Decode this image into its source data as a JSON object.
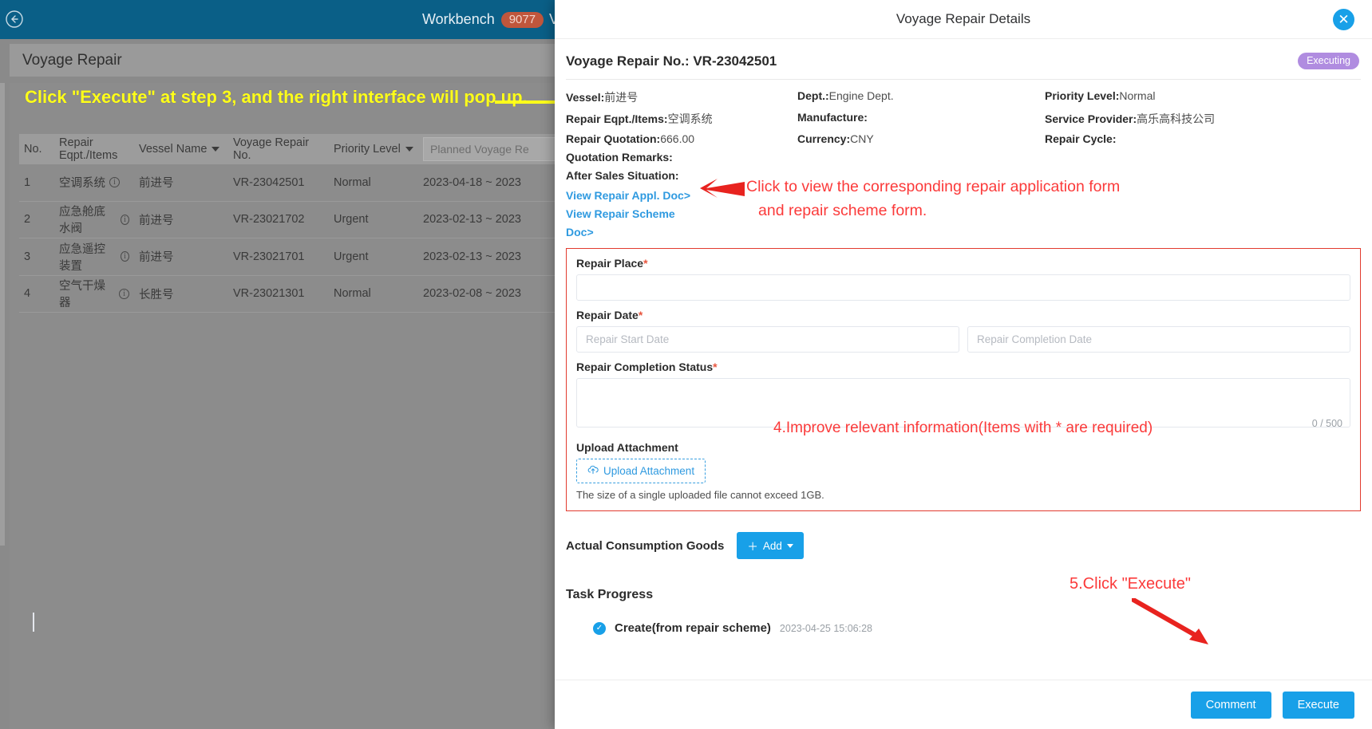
{
  "background": {
    "topbar": {
      "back_icon": "back-arrow-circle-icon",
      "workbench_label": "Workbench",
      "workbench_badge": "9077",
      "next_label": "V",
      "bg_color": "#0a5f87"
    },
    "page_title": "Voyage Repair",
    "annotation_banner": "Click \"Execute\" at step 3, and the right interface will pop up.",
    "table": {
      "columns": [
        {
          "label": "No.",
          "sortable": false
        },
        {
          "label": "Repair Eqpt./Items",
          "sortable": false
        },
        {
          "label": "Vessel Name",
          "sortable": true
        },
        {
          "label": "Voyage Repair No.",
          "sortable": false
        },
        {
          "label": "Priority Level",
          "sortable": true
        },
        {
          "label": "Planned Voyage Re",
          "sortable": false,
          "is_filter": true
        }
      ],
      "rows": [
        {
          "no": "1",
          "eqpt": "空调系统",
          "vessel": "前进号",
          "vrno": "VR-23042501",
          "priority": "Normal",
          "planned": "2023-04-18  ~  2023"
        },
        {
          "no": "2",
          "eqpt": "应急舱底水阀",
          "vessel": "前进号",
          "vrno": "VR-23021702",
          "priority": "Urgent",
          "planned": "2023-02-13  ~  2023"
        },
        {
          "no": "3",
          "eqpt": "应急遥控装置",
          "vessel": "前进号",
          "vrno": "VR-23021701",
          "priority": "Urgent",
          "planned": "2023-02-13  ~  2023"
        },
        {
          "no": "4",
          "eqpt": "空气干燥器",
          "vessel": "长胜号",
          "vrno": "VR-23021301",
          "priority": "Normal",
          "planned": "2023-02-08  ~  2023"
        }
      ]
    }
  },
  "modal": {
    "title": "Voyage Repair Details",
    "close_icon": "close-icon",
    "repair_no_text": "Voyage Repair No.: VR-23042501",
    "status_badge": "Executing",
    "status_badge_color": "#b08ce0",
    "meta": [
      {
        "label": "Vessel:",
        "value": "前进号"
      },
      {
        "label": "Dept.:",
        "value": "Engine Dept."
      },
      {
        "label": "Priority Level:",
        "value": "Normal"
      },
      {
        "label": "Repair Eqpt./Items:",
        "value": "空调系统"
      },
      {
        "label": "Manufacture:",
        "value": ""
      },
      {
        "label": "Service Provider:",
        "value": "高乐高科技公司"
      },
      {
        "label": "Repair Quotation:",
        "value": "666.00"
      },
      {
        "label": "Currency:",
        "value": "CNY"
      },
      {
        "label": "Repair Cycle:",
        "value": ""
      },
      {
        "label": "Quotation Remarks:",
        "value": ""
      },
      {
        "label": "",
        "value": ""
      },
      {
        "label": "",
        "value": ""
      },
      {
        "label": "After Sales Situation:",
        "value": ""
      },
      {
        "label": "",
        "value": ""
      },
      {
        "label": "",
        "value": ""
      }
    ],
    "doc_links": [
      {
        "label": "View Repair Appl. Doc>"
      },
      {
        "label": "View Repair Scheme Doc>"
      }
    ],
    "form": {
      "repair_place_label": "Repair Place",
      "repair_place_value": "",
      "repair_place_placeholder": "",
      "repair_date_label": "Repair Date",
      "repair_start_placeholder": "Repair Start Date",
      "repair_start_value": "",
      "repair_completion_placeholder": "Repair Completion Date",
      "repair_completion_value": "",
      "completion_status_label": "Repair Completion Status",
      "completion_status_value": "",
      "completion_status_counter": "0 / 500",
      "upload_label": "Upload Attachment",
      "upload_button": "Upload Attachment",
      "upload_icon": "cloud-upload-icon",
      "upload_hint": "The size of a single uploaded file cannot exceed 1GB.",
      "required_marker": "*"
    },
    "consumption": {
      "label": "Actual Consumption Goods",
      "add_button": "Add",
      "add_icon": "plus-icon"
    },
    "task_progress": {
      "title": "Task Progress",
      "items": [
        {
          "icon": "check-circle-icon",
          "title": "Create(from repair scheme)",
          "time": "2023-04-25 15:06:28"
        }
      ]
    },
    "footer": {
      "comment_button": "Comment",
      "execute_button": "Execute",
      "button_color": "#18a0e8"
    }
  },
  "annotations": {
    "banner_color": "#ffff1a",
    "red_color": "#fb3a3a",
    "docs_line1": "Click to view the corresponding repair application form",
    "docs_line2": "and repair scheme form.",
    "improve": "4.Improve relevant information(Items with * are required)",
    "execute": "5.Click \"Execute\""
  }
}
